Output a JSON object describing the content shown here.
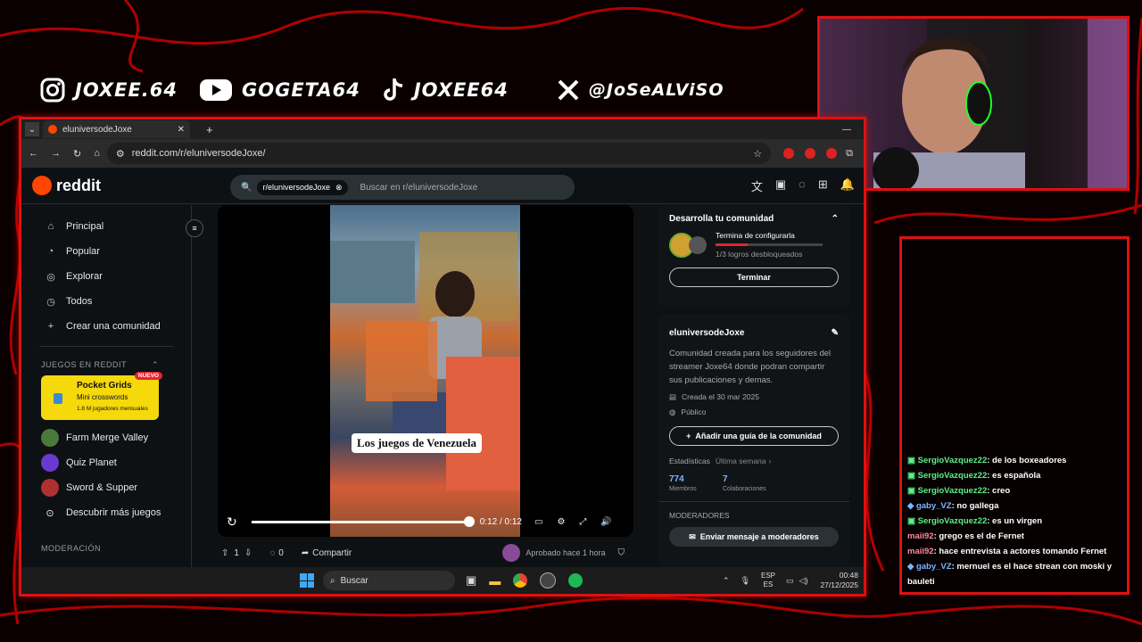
{
  "socials": [
    {
      "icon": "instagram-icon",
      "handle": "JOXEE.64"
    },
    {
      "icon": "youtube-icon",
      "handle": "GOGETA64"
    },
    {
      "icon": "tiktok-icon",
      "handle": "JOXEE64"
    },
    {
      "icon": "x-icon",
      "handle": "@JoSeALViSO"
    }
  ],
  "colors": {
    "frame": "#dd1111",
    "reddit_orange": "#ff4500",
    "accent_blue": "#7ab6ff"
  },
  "browser": {
    "tab_title": "eluniversodeJoxe",
    "url": "reddit.com/r/eluniversodeJoxe/"
  },
  "reddit": {
    "logo": "reddit",
    "search_chip": "r/eluniversodeJoxe",
    "search_placeholder": "Buscar en r/eluniversodeJoxe",
    "nav": [
      {
        "icon": "home-icon",
        "label": "Principal"
      },
      {
        "icon": "popular-icon",
        "label": "Popular"
      },
      {
        "icon": "explore-icon",
        "label": "Explorar"
      },
      {
        "icon": "all-icon",
        "label": "Todos"
      },
      {
        "icon": "plus-icon",
        "label": "Crear una comunidad"
      }
    ],
    "games_header": "JUEGOS EN REDDIT",
    "pocket": {
      "title": "Pocket Grids",
      "subtitle": "Mini crosswords",
      "players": "1.8 M jugadores mensuales",
      "badge": "NUEVO"
    },
    "games": [
      {
        "label": "Farm Merge Valley",
        "color": "#4a7a3a"
      },
      {
        "label": "Quiz Planet",
        "color": "#6a3ad0"
      },
      {
        "label": "Sword & Supper",
        "color": "#b03030"
      }
    ],
    "discover": "Descubrir más juegos",
    "moderation": "MODERACIÓN",
    "video": {
      "caption": "Los juegos de Venezuela",
      "time": "0:12 / 0:12",
      "progress": 1.0
    },
    "post": {
      "votes": "1",
      "comments": "0",
      "share": "Compartir",
      "approved": "Aprobado hace 1 hora"
    },
    "community_card": {
      "title": "Desarrolla tu comunidad",
      "task": "Termina de configurarla",
      "progress": "1/3 logros desbloqueados",
      "button": "Terminar"
    },
    "about": {
      "name": "eluniversodeJoxe",
      "desc": "Comunidad creada para los seguidores del streamer Joxe64 donde podran compartir sus publicaciones y demas.",
      "created": "Creada el 30 mar 2025",
      "visibility": "Público",
      "guide_button": "Añadir una guía de la comunidad",
      "stats_label": "Estadísticas",
      "stats_period": "Última semana",
      "members_value": "774",
      "members_label": "Miembros",
      "contrib_value": "7",
      "contrib_label": "Colaboraciones",
      "mods_header": "MODERADORES",
      "mods_button": "Enviar mensaje a moderadores"
    }
  },
  "taskbar": {
    "search": "Buscar",
    "lang1": "ESP",
    "lang2": "ES",
    "time": "00:48",
    "date": "27/12/2025"
  },
  "chat": [
    {
      "user": "SergioVazquez22",
      "text": ": de los boxeadores",
      "cls": "u1"
    },
    {
      "user": "SergioVazquez22",
      "text": ": es española",
      "cls": "u1"
    },
    {
      "user": "SergioVazquez22",
      "text": ": creo",
      "cls": "u1"
    },
    {
      "user": "gaby_VZ",
      "text": ": no gallega",
      "cls": "u2"
    },
    {
      "user": "SergioVazquez22",
      "text": ": es un virgen",
      "cls": "u1"
    },
    {
      "user": "maii92",
      "text": ": grego es el de Fernet",
      "cls": "u3"
    },
    {
      "user": "maii92",
      "text": ": hace entrevista a actores tomando Fernet",
      "cls": "u3"
    },
    {
      "user": "gaby_VZ",
      "text": ": mernuel es el hace strean con moski y bauleti",
      "cls": "u2"
    }
  ]
}
